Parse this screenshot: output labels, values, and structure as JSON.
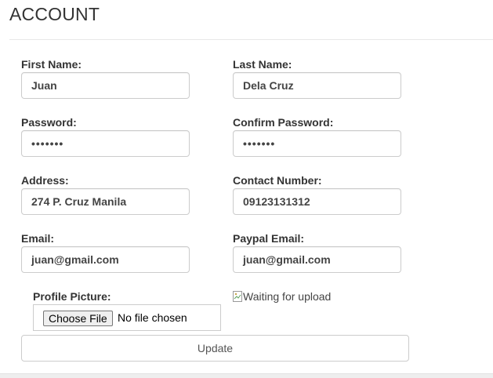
{
  "page": {
    "title": "ACCOUNT"
  },
  "form": {
    "first_name": {
      "label": "First Name:",
      "value": "Juan"
    },
    "last_name": {
      "label": "Last Name:",
      "value": "Dela Cruz"
    },
    "password": {
      "label": "Password:",
      "value": "•••••••"
    },
    "confirm_password": {
      "label": "Confirm Password:",
      "value": "•••••••"
    },
    "address": {
      "label": "Address:",
      "value": "274 P. Cruz Manila"
    },
    "contact_number": {
      "label": "Contact Number:",
      "value": "09123131312"
    },
    "email": {
      "label": "Email:",
      "value": "juan@gmail.com"
    },
    "paypal_email": {
      "label": "Paypal Email:",
      "value": "juan@gmail.com"
    },
    "profile_picture": {
      "label": "Profile Picture:",
      "button_label": "Choose File",
      "status": "No file chosen"
    },
    "image_preview_alt": "Waiting for upload",
    "update_label": "Update"
  },
  "icons": {
    "image_preview": "broken-image-icon"
  }
}
